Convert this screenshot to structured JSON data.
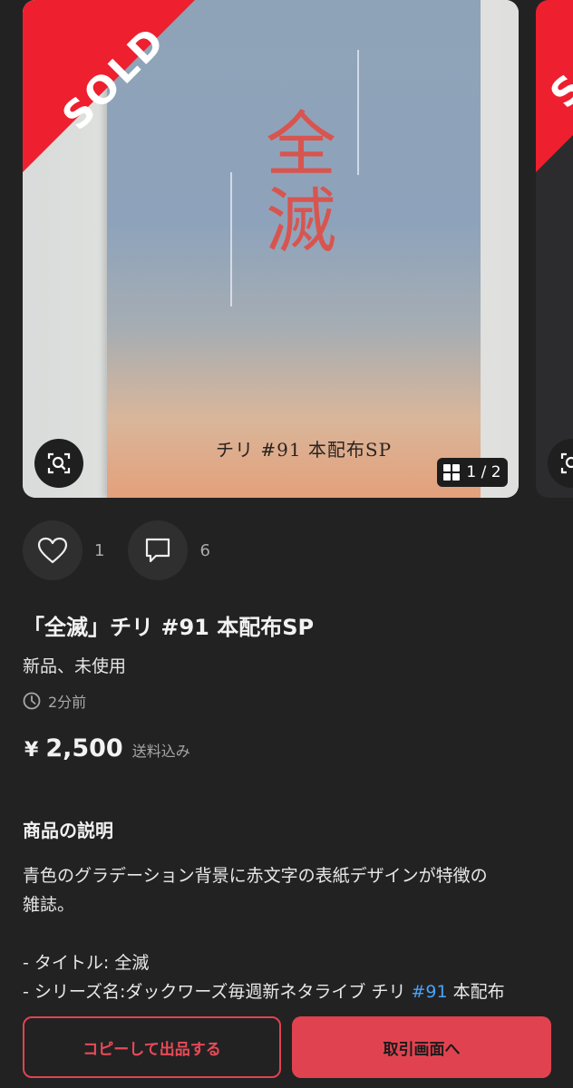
{
  "carousel": {
    "sold_label": "SOLD",
    "sold_label_next": "S",
    "counter_current": "1",
    "counter_separator": "/",
    "counter_total": "2",
    "zoom_icon": "zoom-search-icon",
    "counter_icon": "grid-icon",
    "photo": {
      "cover_title": "全滅",
      "cover_subtitle": "チリ #91 本配布SP"
    }
  },
  "actions": {
    "like_icon": "heart-icon",
    "like_count": "1",
    "comment_icon": "comment-icon",
    "comment_count": "6"
  },
  "item": {
    "title": "「全滅」チリ #91 本配布SP",
    "condition": "新品、未使用",
    "posted": "2分前",
    "currency": "¥",
    "price": "2,500",
    "shipping": "送料込み"
  },
  "description": {
    "heading": "商品の説明",
    "line1": "青色のグラデーション背景に赤文字の表紙デザインが特徴の",
    "line2": "雑誌。",
    "line3": "- タイトル: 全滅",
    "line4_prefix": "- シリーズ名:ダックワーズ毎週新ネタライブ チリ ",
    "line4_hashtag": "#91",
    "line4_suffix": " 本配布"
  },
  "bottom": {
    "copy_button": "コピーして出品する",
    "trade_button": "取引画面へ"
  },
  "colors": {
    "accent": "#e0434f",
    "sold_red": "#ee1f2e",
    "hashtag": "#4aa3f5",
    "background": "#222223"
  }
}
